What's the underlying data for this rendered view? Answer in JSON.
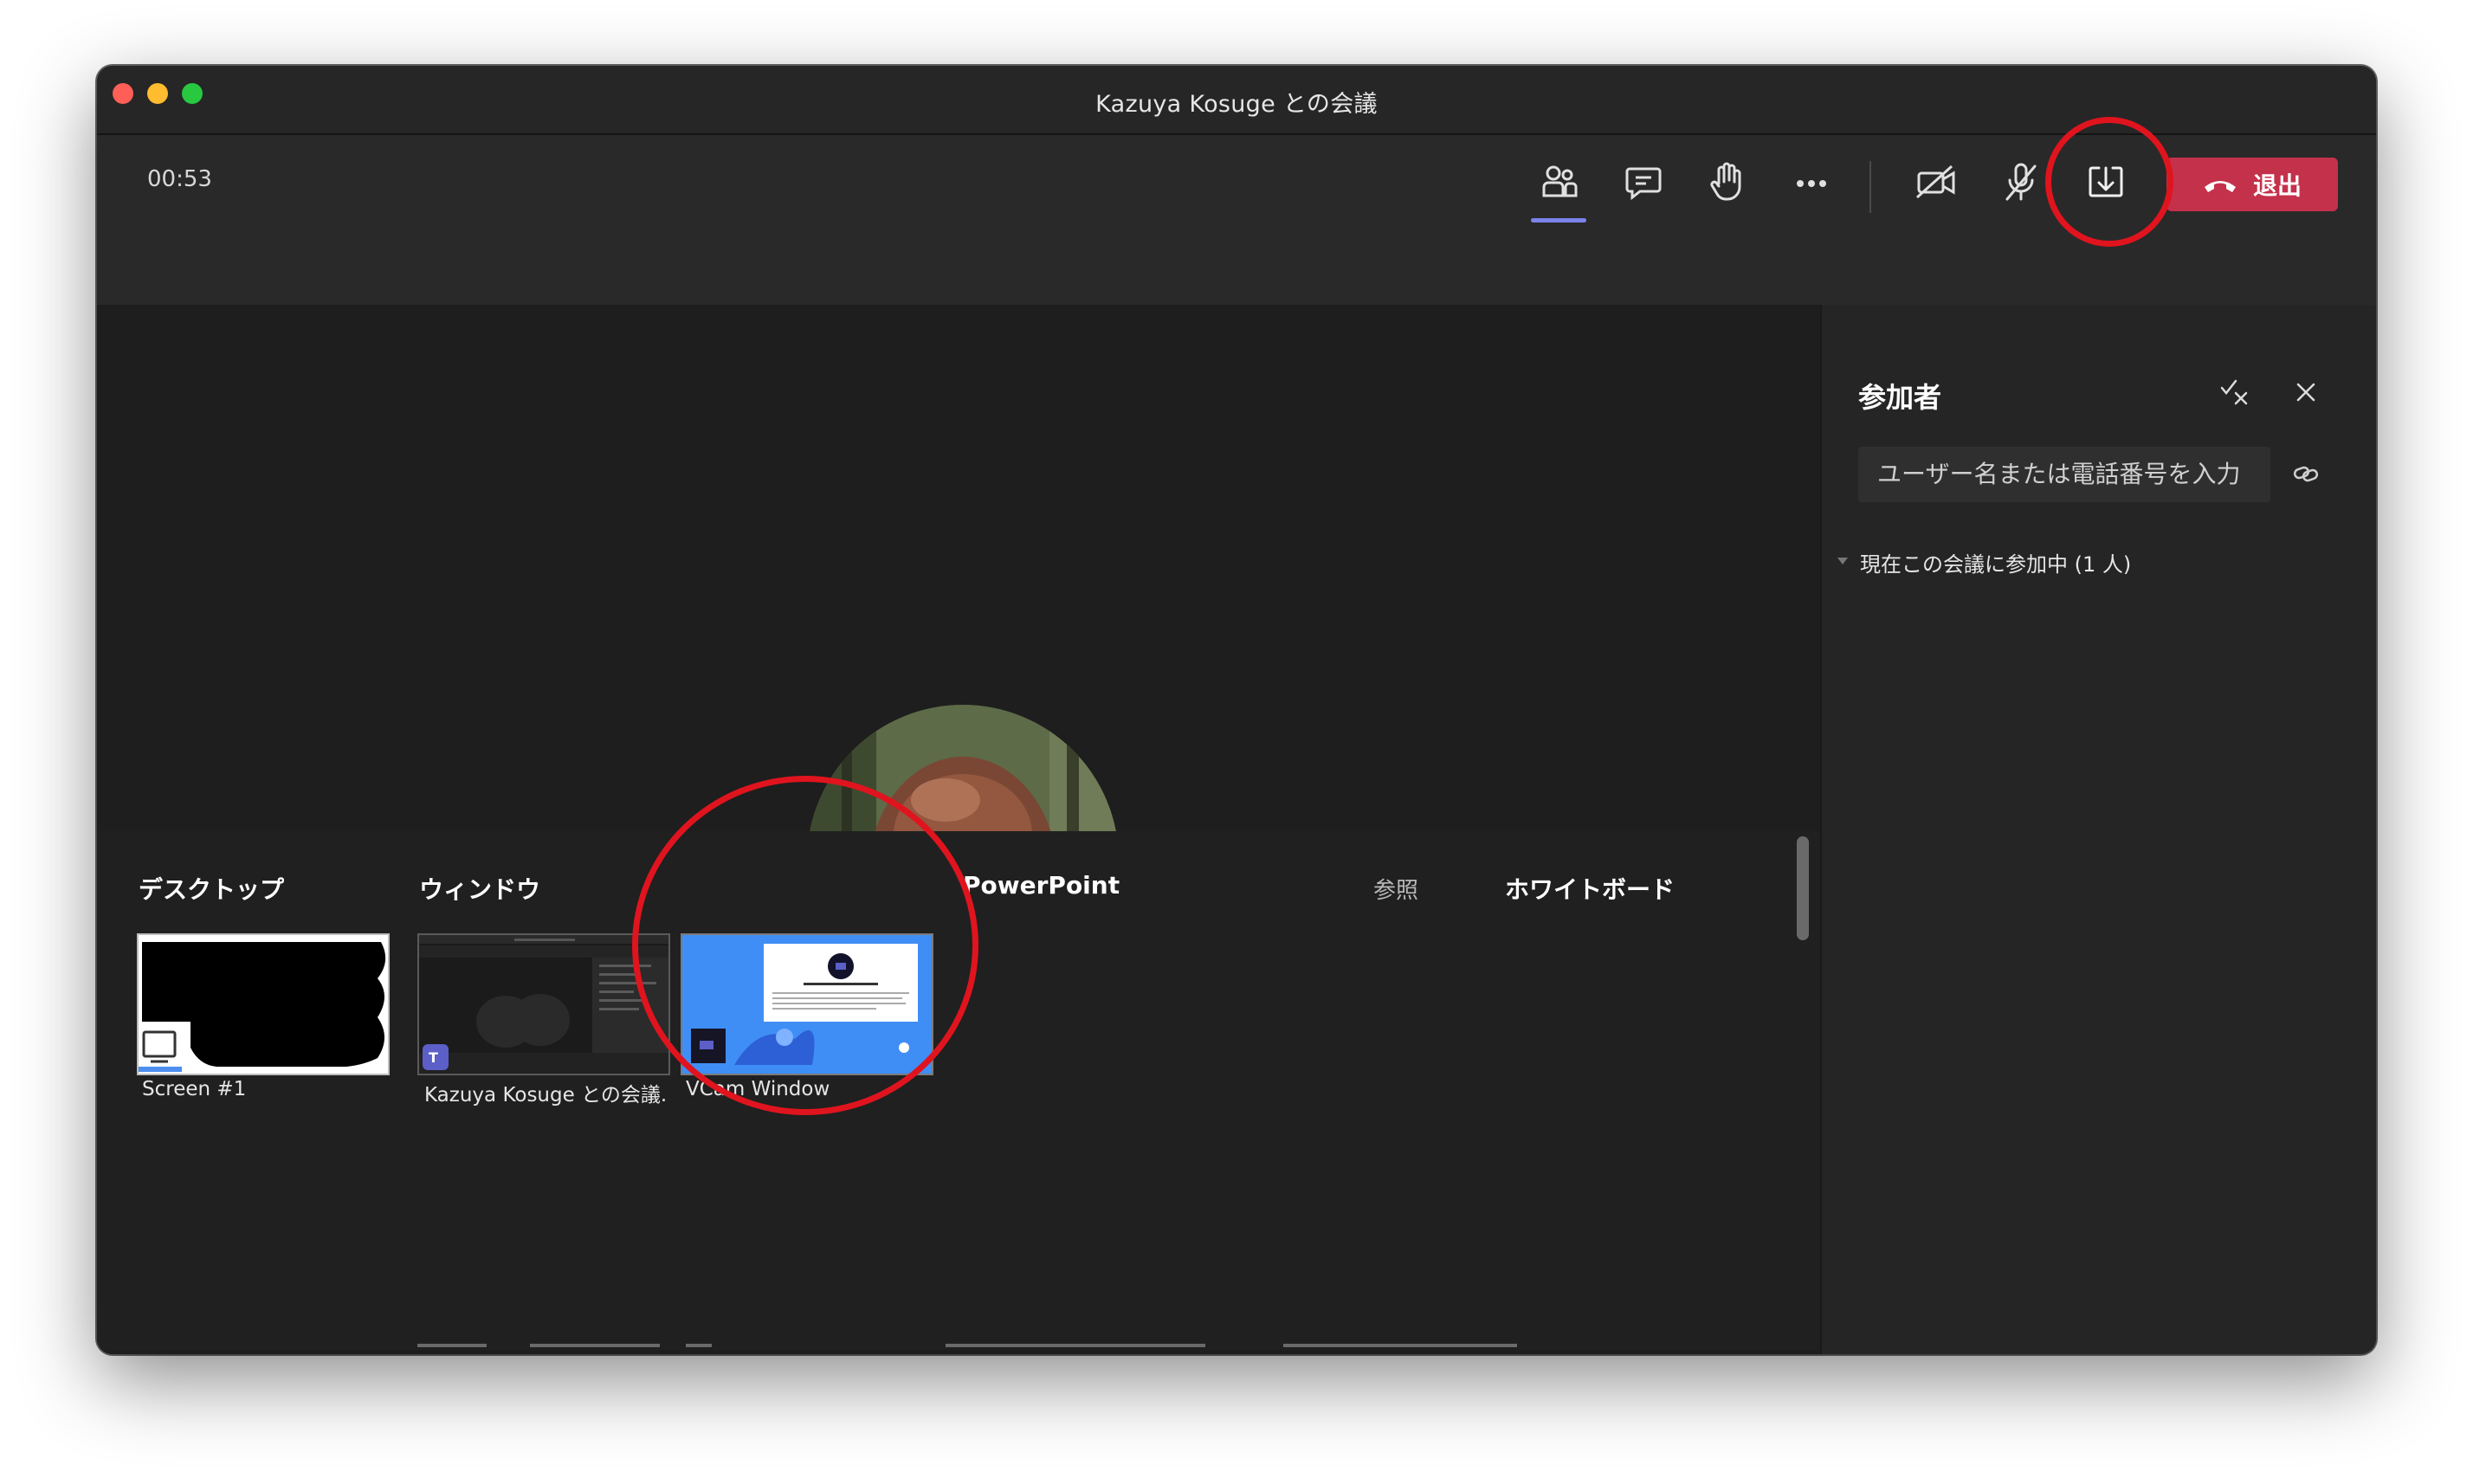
{
  "window": {
    "title": "Kazuya Kosuge との会議"
  },
  "toolbar": {
    "timer": "00:53",
    "icons": [
      "people-icon",
      "chat-icon",
      "raise-hand-icon",
      "more-icon",
      "camera-off-icon",
      "mic-off-icon",
      "share-tray-icon"
    ],
    "leave_label": "退出",
    "leave_color": "#c4314b",
    "active_underline_color": "#7b83eb"
  },
  "share_tray": {
    "categories": {
      "desktop": "デスクトップ",
      "window": "ウィンドウ",
      "powerpoint": "PowerPoint",
      "browse": "参照",
      "whiteboard": "ホワイトボード"
    },
    "items": [
      {
        "label": "Screen #1"
      },
      {
        "label": "Kazuya Kosuge との会議..."
      },
      {
        "label": "VCam Window"
      }
    ]
  },
  "participants_panel": {
    "title": "参加者",
    "search_placeholder": "ユーザー名または電話番号を入力",
    "current_header": "現在この会議に参加中 (1 人)"
  },
  "annotation_color": "#e0141e"
}
